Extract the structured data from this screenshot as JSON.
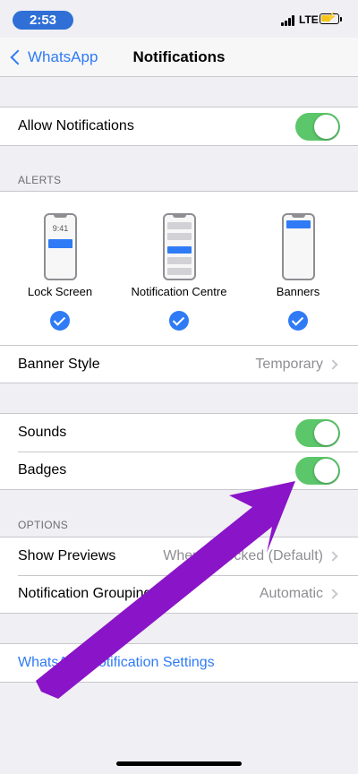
{
  "status": {
    "time": "2:53",
    "network": "LTE"
  },
  "nav": {
    "back_label": "WhatsApp",
    "title": "Notifications"
  },
  "allow": {
    "label": "Allow Notifications",
    "on": true
  },
  "alerts": {
    "header": "ALERTS",
    "lock_time": "9:41",
    "items": [
      {
        "label": "Lock Screen",
        "checked": true
      },
      {
        "label": "Notification Centre",
        "checked": true
      },
      {
        "label": "Banners",
        "checked": true
      }
    ],
    "banner_style": {
      "label": "Banner Style",
      "value": "Temporary"
    }
  },
  "sounds": {
    "label": "Sounds",
    "on": true
  },
  "badges": {
    "label": "Badges",
    "on": true
  },
  "options": {
    "header": "OPTIONS",
    "show_previews": {
      "label": "Show Previews",
      "value": "When Unlocked (Default)"
    },
    "grouping": {
      "label": "Notification Grouping",
      "value": "Automatic"
    }
  },
  "settings_link": {
    "label": "WhatsApp Notification Settings"
  },
  "colors": {
    "accent": "#2f7bf5",
    "toggle_on": "#5cc66a",
    "arrow": "#8a14c8"
  }
}
